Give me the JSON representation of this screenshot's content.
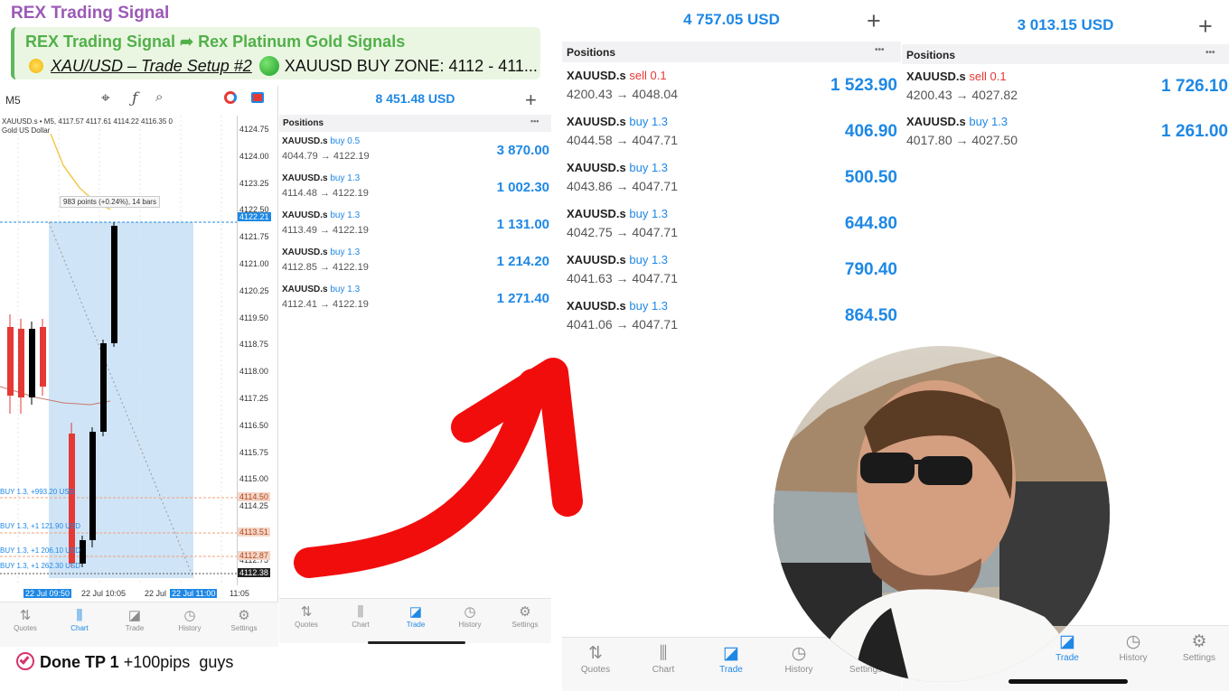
{
  "telegram": {
    "channel_title": "REX Trading Signal",
    "reply_from": "REX Trading Signal",
    "reply_arrow": "➦",
    "reply_to": "Rex Platinum Gold Signals",
    "setup_text": "XAU/USD – Trade Setup #2",
    "zone_text": "XAUUSD BUY ZONE: 4112 - 411...",
    "message_tp": "Done TP 1",
    "message_pips": "+100pips",
    "message_tail": "guys"
  },
  "chart": {
    "timeframe": "M5",
    "info_line": "XAUUSD.s • M5, 4117.57 4117.61 4114.22 4116.35 0",
    "symbol_desc": "Gold US Dollar",
    "measure_label": "983 points (+0.24%), 14 bars",
    "price_ticks": [
      "4124.75",
      "4124.00",
      "4123.25",
      "4122.50",
      "4121.75",
      "4121.00",
      "4120.25",
      "4119.50",
      "4118.75",
      "4118.00",
      "4117.25",
      "4116.50",
      "4115.75",
      "4115.00",
      "4114.25",
      "4113.50",
      "4112.75"
    ],
    "highlight_prices": [
      "4122.21",
      "4114.50",
      "4113.51",
      "4112.87",
      "4112.38"
    ],
    "trade_labels": [
      "BUY 1.3, +993.20 USD",
      "BUY 1.3, +1 121.90 USD",
      "BUY 1.3, +1 206.10 USD",
      "BUY 1.3, +1 262.30 USD"
    ],
    "time_labels": [
      "22 Jul 09:50",
      "22 Jul 10:05",
      "22 Jul",
      "22 Jul 11:00",
      "11:05"
    ],
    "colors": {
      "bull": "#000000",
      "bear": "#e53935",
      "selection": "#cfe4f7"
    }
  },
  "nav_labels": [
    "Quotes",
    "Chart",
    "Trade",
    "History",
    "Settings"
  ],
  "screen1": {
    "balance": "8 451.48 USD",
    "positions_label": "Positions",
    "rows": [
      {
        "symbol": "XAUUSD.s",
        "side": "buy 0.5",
        "prices": "4044.79 → 4122.19",
        "profit": "3 870.00"
      },
      {
        "symbol": "XAUUSD.s",
        "side": "buy 1.3",
        "prices": "4114.48 → 4122.19",
        "profit": "1 002.30"
      },
      {
        "symbol": "XAUUSD.s",
        "side": "buy 1.3",
        "prices": "4113.49 → 4122.19",
        "profit": "1 131.00"
      },
      {
        "symbol": "XAUUSD.s",
        "side": "buy 1.3",
        "prices": "4112.85 → 4122.19",
        "profit": "1 214.20"
      },
      {
        "symbol": "XAUUSD.s",
        "side": "buy 1.3",
        "prices": "4112.41 → 4122.19",
        "profit": "1 271.40"
      }
    ]
  },
  "screen2": {
    "balance": "4 757.05 USD",
    "positions_label": "Positions",
    "rows": [
      {
        "symbol": "XAUUSD.s",
        "side": "sell 0.1",
        "prices": "4200.43 → 4048.04",
        "profit": "1 523.90"
      },
      {
        "symbol": "XAUUSD.s",
        "side": "buy 1.3",
        "prices": "4044.58 → 4047.71",
        "profit": "406.90"
      },
      {
        "symbol": "XAUUSD.s",
        "side": "buy 1.3",
        "prices": "4043.86 → 4047.71",
        "profit": "500.50"
      },
      {
        "symbol": "XAUUSD.s",
        "side": "buy 1.3",
        "prices": "4042.75 → 4047.71",
        "profit": "644.80"
      },
      {
        "symbol": "XAUUSD.s",
        "side": "buy 1.3",
        "prices": "4041.63 → 4047.71",
        "profit": "790.40"
      },
      {
        "symbol": "XAUUSD.s",
        "side": "buy 1.3",
        "prices": "4041.06 → 4047.71",
        "profit": "864.50"
      }
    ]
  },
  "screen3": {
    "balance": "3 013.15 USD",
    "positions_label": "Positions",
    "rows": [
      {
        "symbol": "XAUUSD.s",
        "side": "sell 0.1",
        "prices": "4200.43 → 4027.82",
        "profit": "1 726.10"
      },
      {
        "symbol": "XAUUSD.s",
        "side": "buy 1.3",
        "prices": "4017.80 → 4027.50",
        "profit": "1 261.00"
      }
    ]
  },
  "icons": {
    "plus": "+",
    "more": "•••",
    "check": "check-circle-icon"
  }
}
